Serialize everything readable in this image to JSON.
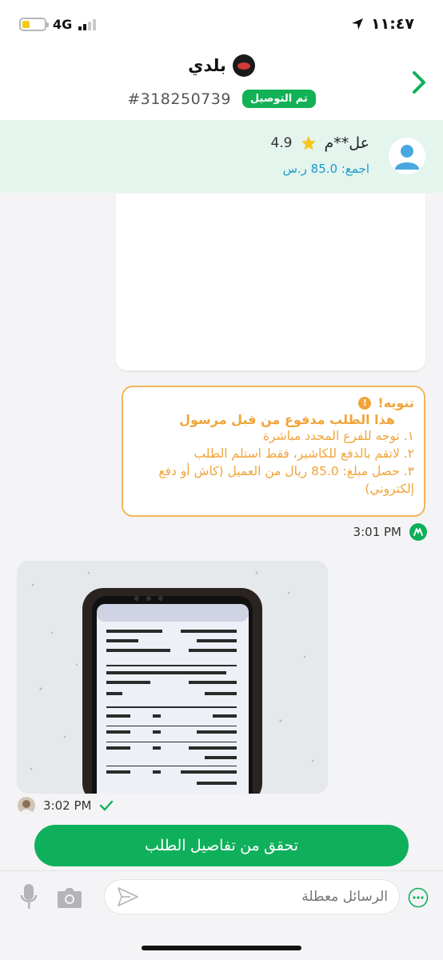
{
  "status_bar": {
    "time": "١١:٤٧",
    "network": "4G",
    "battery_level": 0.25
  },
  "header": {
    "restaurant_name": "بلدي",
    "order_number": "#318250739",
    "order_status": "تم التوصيل"
  },
  "customer": {
    "name": "عل**م",
    "rating": "4.9",
    "total_label": "اجمع:",
    "total_value": "85.0 ر.س"
  },
  "notice": {
    "title": "تنويه!",
    "subtitle": "هذا الطلب مدفوع من قبل مرسول",
    "lines": [
      "١. توجه للفرع المحدد مباشرة",
      "٢. لاتقم بالدفع للكاشير، فقط استلم الطلب",
      "٣. حصل مبلغ: 85.0 ريال من العميل (كاش أو دفع إلكتروني)"
    ],
    "time": "3:01 PM"
  },
  "image_message": {
    "time": "3:02 PM"
  },
  "actions": {
    "order_details_label": "تحقق من تفاصيل الطلب"
  },
  "input": {
    "placeholder": "الرسائل معطلة"
  },
  "colors": {
    "brand_green": "#0fb05c",
    "notice_orange": "#f0a53a",
    "customer_bg": "#e4f5ee",
    "total_blue": "#1a9ccc"
  }
}
